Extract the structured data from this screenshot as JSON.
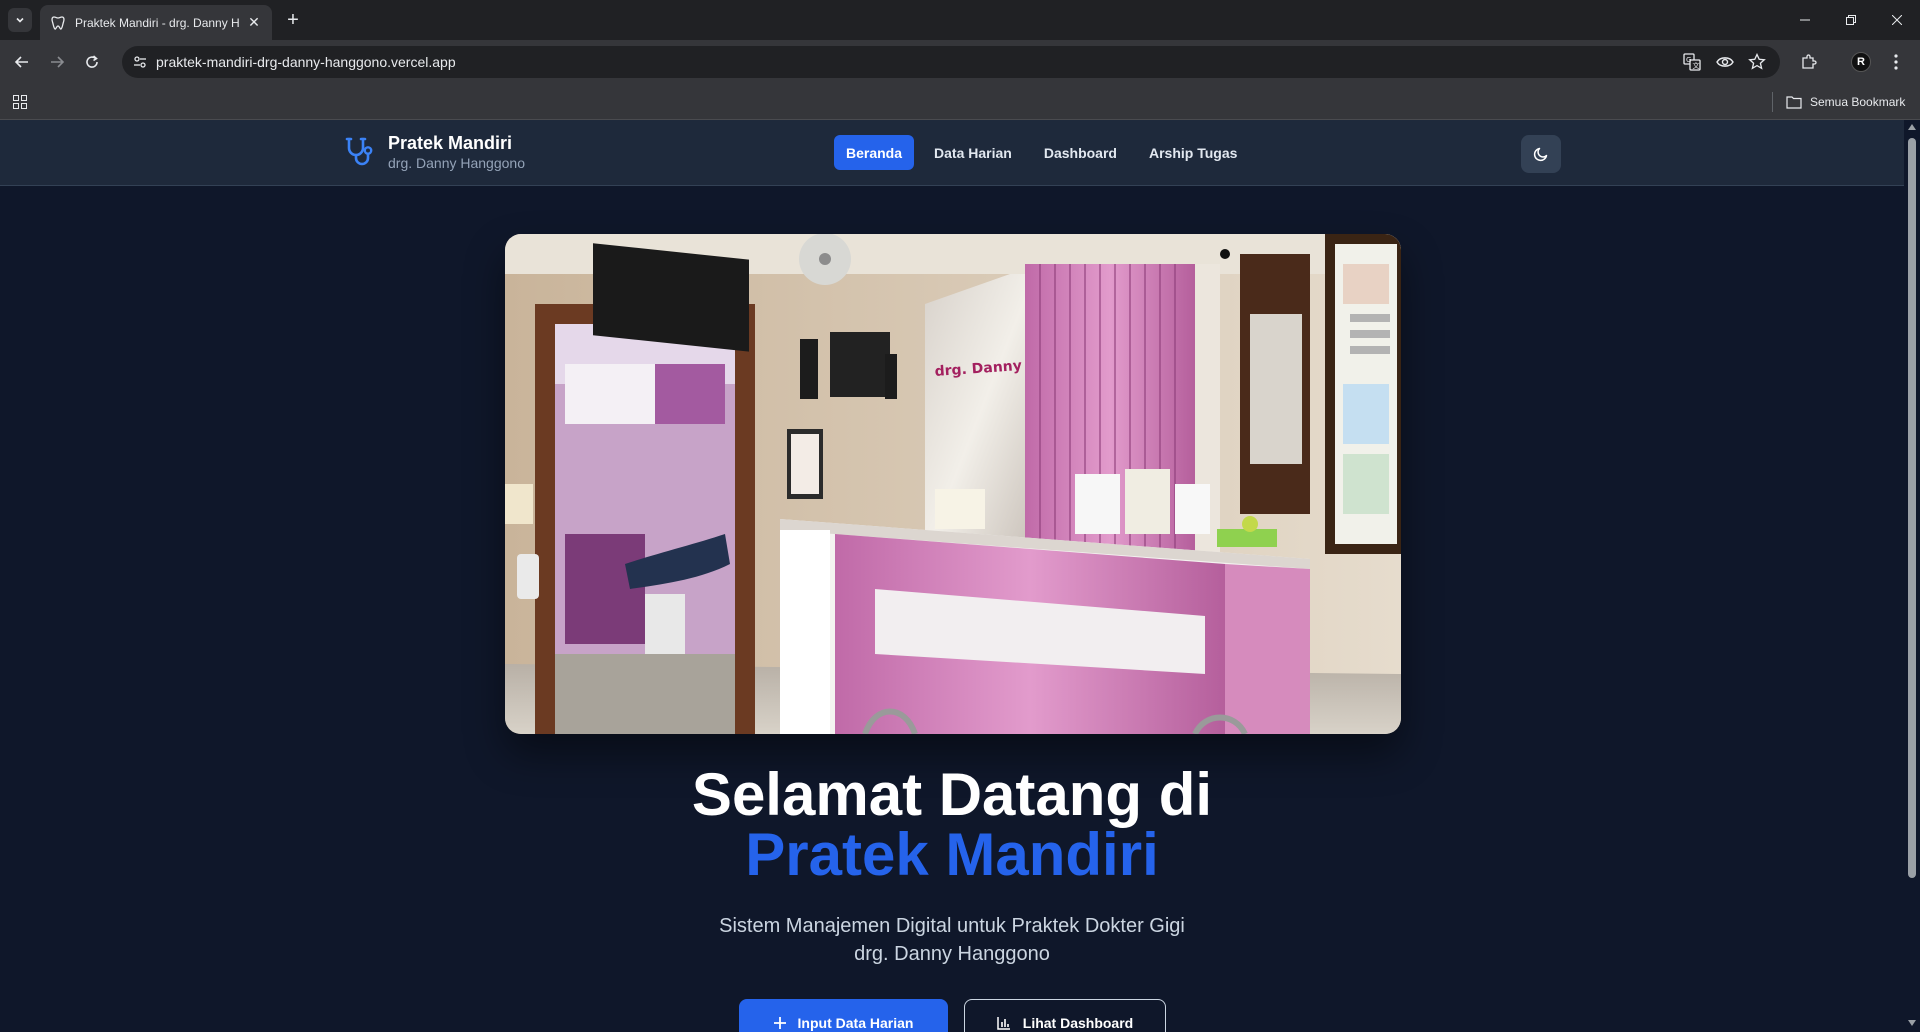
{
  "browser": {
    "tab_title": "Praktek Mandiri - drg. Danny H",
    "url": "praktek-mandiri-drg-danny-hanggono.vercel.app",
    "bookmarks_folder": "Semua Bookmark",
    "profile_initial": "R"
  },
  "header": {
    "brand_title": "Pratek Mandiri",
    "brand_subtitle": "drg. Danny Hanggono",
    "nav": [
      {
        "label": "Beranda",
        "active": true
      },
      {
        "label": "Data Harian",
        "active": false
      },
      {
        "label": "Dashboard",
        "active": false
      },
      {
        "label": "Arship Tugas",
        "active": false
      }
    ],
    "theme_icon": "moon-icon"
  },
  "hero": {
    "image_alt": "drg. Danny H.",
    "title_line1": "Selamat Datang di",
    "title_line2": "Pratek Mandiri",
    "desc_line1": "Sistem Manajemen Digital untuk Praktek Dokter Gigi",
    "desc_line2": "drg. Danny Hanggono",
    "primary_button": "Input Data Harian",
    "secondary_button": "Lihat Dashboard"
  },
  "colors": {
    "accent": "#2563eb",
    "background": "#0f172a",
    "header": "#1e293b"
  }
}
